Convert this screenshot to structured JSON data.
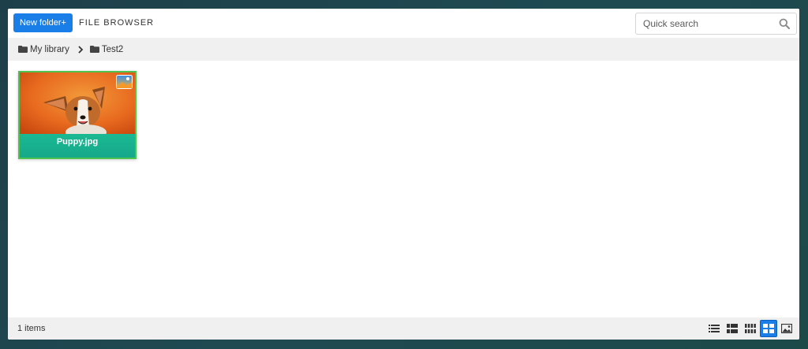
{
  "toolbar": {
    "new_folder_label": "New folder+",
    "title": "FILE BROWSER",
    "search_placeholder": "Quick search"
  },
  "breadcrumb": [
    {
      "label": "My library"
    },
    {
      "label": "Test2"
    }
  ],
  "files": [
    {
      "name": "Puppy.jpg",
      "type": "image",
      "icon": "image-icon"
    }
  ],
  "status": {
    "item_count": "1 items"
  },
  "view_modes": [
    {
      "icon": "list-view-icon",
      "active": false
    },
    {
      "icon": "detail-list-view-icon",
      "active": false
    },
    {
      "icon": "small-grid-view-icon",
      "active": false
    },
    {
      "icon": "large-grid-view-icon",
      "active": true
    },
    {
      "icon": "image-view-icon",
      "active": false
    }
  ],
  "colors": {
    "accent": "#1a7ee8",
    "card_label": "#1ab993",
    "card_border": "#4fc34f"
  }
}
